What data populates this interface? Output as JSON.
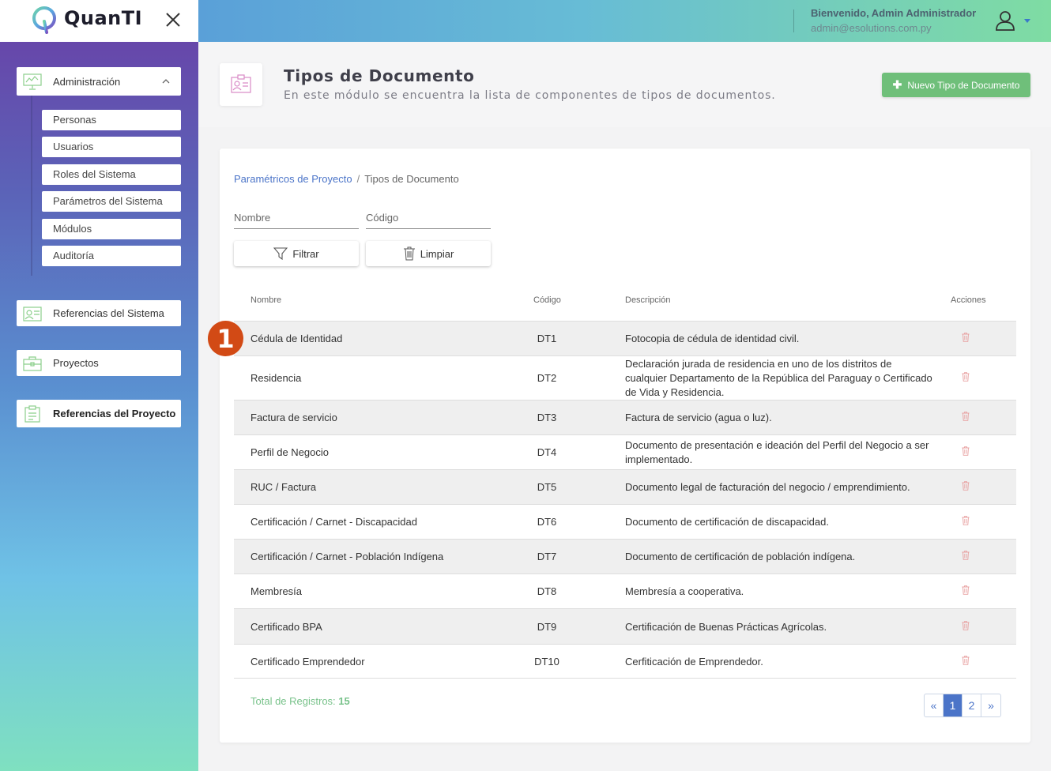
{
  "brand": {
    "name": "QuanTI"
  },
  "header": {
    "welcome": "Bienvenido, Admin Administrador",
    "email": "admin@esolutions.com.py"
  },
  "sidebar": {
    "admin_label": "Administración",
    "sub_items": [
      "Personas",
      "Usuarios",
      "Roles del Sistema",
      "Parámetros del Sistema",
      "Módulos",
      "Auditoría"
    ],
    "ref_sistema": "Referencias del Sistema",
    "proyectos": "Proyectos",
    "ref_proyecto": "Referencias del Proyecto"
  },
  "page": {
    "title": "Tipos de Documento",
    "subtitle": "En este módulo se encuentra la lista de componentes de tipos de documentos.",
    "new_button": "Nuevo Tipo de Documento",
    "new_button_plus": "✚"
  },
  "breadcrumb": {
    "parent": "Paramétricos de Proyecto",
    "separator": "/",
    "current": "Tipos de Documento"
  },
  "filters": {
    "nombre_placeholder": "Nombre",
    "codigo_placeholder": "Código",
    "filter_button": "Filtrar",
    "clear_button": "Limpiar"
  },
  "table": {
    "headers": {
      "name": "Nombre",
      "code": "Código",
      "desc": "Descripción",
      "actions": "Acciones"
    },
    "rows": [
      {
        "name": "Cédula de Identidad",
        "code": "DT1",
        "desc": "Fotocopia de cédula de identidad civil."
      },
      {
        "name": "Residencia",
        "code": "DT2",
        "desc": "Declaración jurada de residencia en uno de los distritos de cualquier Departamento de la República del Paraguay o Certificado de Vida y Residencia."
      },
      {
        "name": "Factura de servicio",
        "code": "DT3",
        "desc": "Factura de servicio (agua o luz)."
      },
      {
        "name": "Perfil de Negocio",
        "code": "DT4",
        "desc": "Documento de presentación e ideación del Perfil del Negocio a ser implementado."
      },
      {
        "name": "RUC / Factura",
        "code": "DT5",
        "desc": "Documento legal de facturación del negocio / emprendimiento."
      },
      {
        "name": "Certificación / Carnet - Discapacidad",
        "code": "DT6",
        "desc": "Documento de certificación de discapacidad."
      },
      {
        "name": "Certificación / Carnet - Población Indígena",
        "code": "DT7",
        "desc": "Documento de certificación de población indígena."
      },
      {
        "name": "Membresía",
        "code": "DT8",
        "desc": "Membresía a cooperativa."
      },
      {
        "name": "Certificado BPA",
        "code": "DT9",
        "desc": "Certificación de Buenas Prácticas Agrícolas."
      },
      {
        "name": "Certificado Emprendedor",
        "code": "DT10",
        "desc": "Cerfiticación de Emprendedor."
      }
    ]
  },
  "footer": {
    "total_label": "Total de Registros:",
    "total_value": "15",
    "pager": {
      "prev": "«",
      "pages": [
        "1",
        "2"
      ],
      "next": "»",
      "active": "1"
    }
  },
  "annotation": {
    "badge": "1"
  },
  "colors": {
    "accent_blue": "#4b74c8",
    "accent_green": "#6fbf7a",
    "delete_icon": "#e8a0a0",
    "badge": "#d24a15"
  }
}
